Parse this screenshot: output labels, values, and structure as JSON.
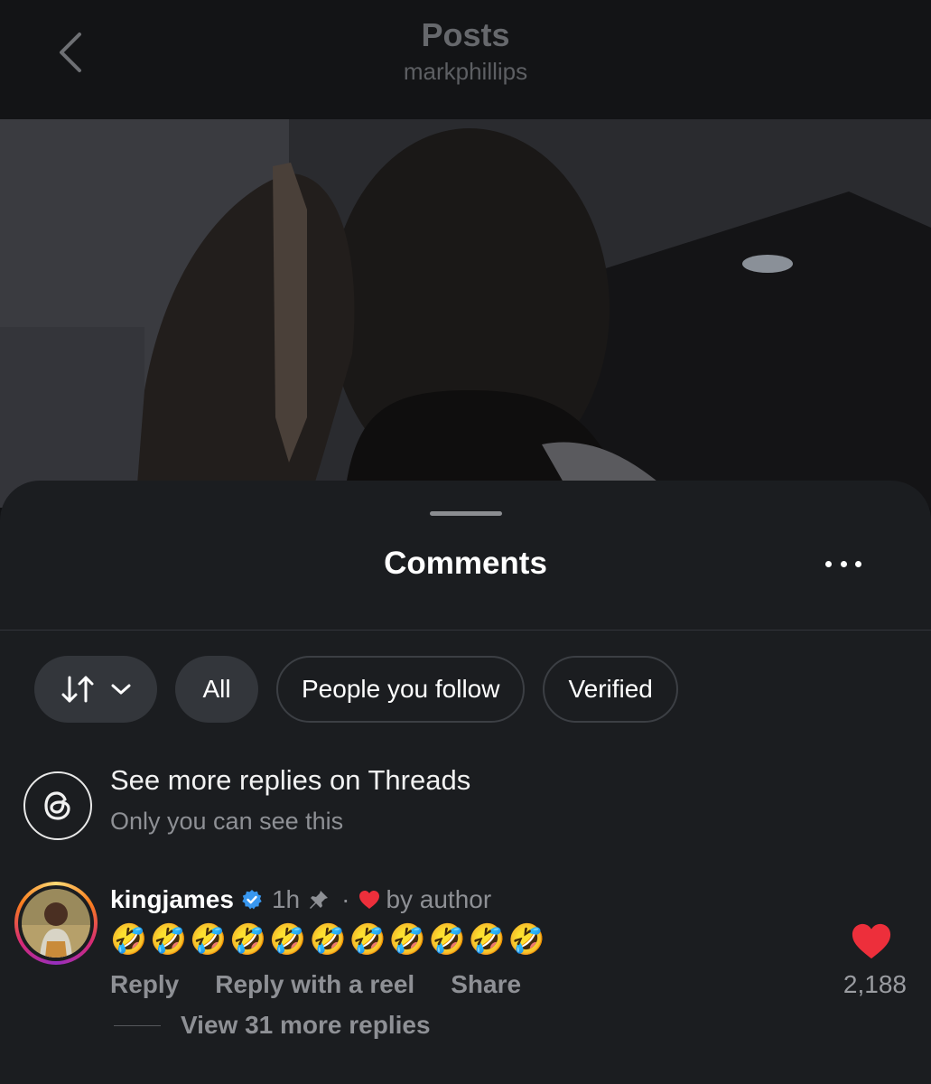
{
  "header": {
    "title": "Posts",
    "username": "markphillips"
  },
  "sheet": {
    "title": "Comments"
  },
  "filters": {
    "sort_icon": "sort-arrows-icon",
    "chips": [
      "All",
      "People you follow",
      "Verified"
    ]
  },
  "threads_prompt": {
    "title": "See more replies on Threads",
    "subtitle": "Only you can see this",
    "icon": "threads-logo-icon"
  },
  "comment": {
    "username": "kingjames",
    "time": "1h",
    "separator": "·",
    "liked_by": "by author",
    "text": "🤣🤣🤣🤣🤣🤣🤣🤣🤣🤣🤣",
    "actions": [
      "Reply",
      "Reply with a reel",
      "Share"
    ],
    "view_replies": "View 31 more replies",
    "like_count": "2,188"
  },
  "colors": {
    "heart": "#ed2f3b",
    "verified": "#3897f0",
    "muted_text": "#8e9095"
  }
}
